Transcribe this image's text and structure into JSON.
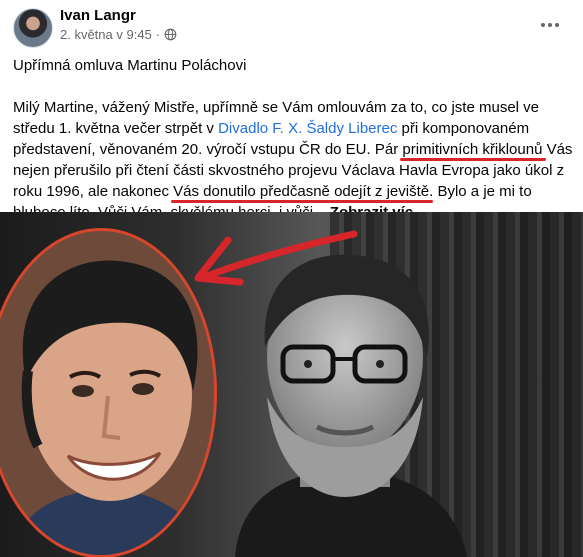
{
  "post": {
    "author": "Ivan Langr",
    "timestamp": "2. května v 9:45",
    "separator": "·",
    "privacy_icon": "globe-icon",
    "more_icon": "more-horizontal-icon",
    "title": "Upřímná omluva Martinu Poláchovi",
    "text_parts": {
      "p1": "Milý Martine, vážený Mistře, upřímně se Vám omlouvám za to, co jste musel ve středu 1. května večer strpět v ",
      "link": "Divadlo F. X. Šaldy Liberec",
      "p2": " při komponovaném představení, věnovaném 20. výročí vstupu ČR do EU. Pár ",
      "hl1": "primitivních křiklounů",
      "p3": " Vás nejen přerušilo při čtení části skvostného projevu Václava Havla Evropa jako úkol z roku 1996, ale nakonec ",
      "hl2": "Vás donutilo předčasně odejít z jeviště",
      "p4": ". Bylo a je mi to hluboce líto. Vůči Vám, skvělému herci, i vůči... ",
      "see_more": "Zobrazit víc"
    }
  },
  "colors": {
    "link": "#216fdb",
    "annotation_red": "#d7262b",
    "meta_gray": "#65676b"
  }
}
